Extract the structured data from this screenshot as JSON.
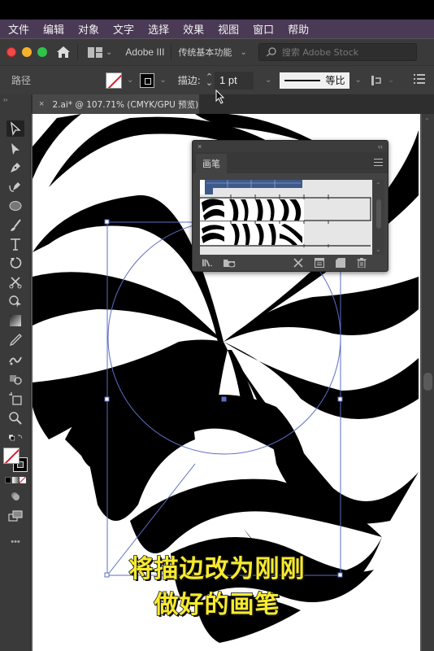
{
  "menubar": {
    "items": [
      "文件",
      "编辑",
      "对象",
      "文字",
      "选择",
      "效果",
      "视图",
      "窗口",
      "帮助"
    ]
  },
  "appbar": {
    "bridge_label": "Adobe III",
    "workspace": "传统基本功能",
    "stock_search_placeholder": "搜索 Adobe Stock"
  },
  "control_bar": {
    "selection_type": "路径",
    "stroke_label": "描边:",
    "stroke_weight": "1 pt",
    "profile_label": "等比",
    "fill_color": "none",
    "stroke_color": "#000000"
  },
  "document_tab": {
    "close": "×",
    "title": "2.ai* @ 107.71% (CMYK/GPU 预览)"
  },
  "tools": [
    {
      "name": "selection-tool",
      "active": true
    },
    {
      "name": "direct-selection-tool"
    },
    {
      "name": "pen-tool"
    },
    {
      "name": "curvature-tool"
    },
    {
      "name": "ellipse-tool"
    },
    {
      "name": "paintbrush-tool"
    },
    {
      "name": "type-tool"
    },
    {
      "name": "rotate-tool"
    },
    {
      "name": "scissors-tool"
    },
    {
      "name": "puppet-warp-tool"
    },
    {
      "name": "gradient-tool"
    },
    {
      "name": "eyedropper-tool"
    },
    {
      "name": "blend-tool"
    },
    {
      "name": "shape-builder-tool"
    },
    {
      "name": "artboard-tool"
    },
    {
      "name": "zoom-tool"
    }
  ],
  "brush_panel": {
    "close": "×",
    "collapse": "‹‹",
    "tab_label": "画笔",
    "brushes": [
      {
        "name": "pattern-brush-ruler",
        "selected": true
      },
      {
        "name": "zebra-pattern-brush-1"
      },
      {
        "name": "zebra-pattern-brush-2"
      }
    ],
    "footer_icons": [
      "brush-libraries-icon",
      "libraries-panel-icon",
      "remove-brush-stroke-icon",
      "brush-options-icon",
      "new-brush-icon",
      "delete-brush-icon"
    ]
  },
  "caption": {
    "line1": "将描边改为刚刚",
    "line2": "做好的画笔"
  },
  "toolbar_more": "•••"
}
